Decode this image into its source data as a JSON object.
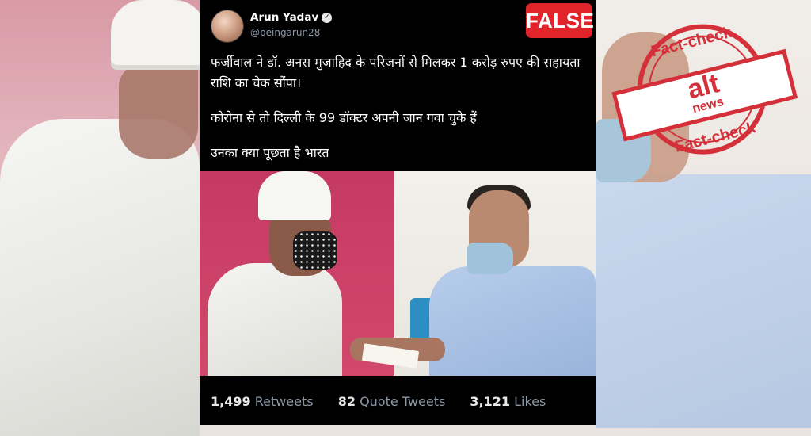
{
  "tweet": {
    "author_name": "Arun Yadav",
    "author_handle": "@beingarun28",
    "verified_icon": "verified-badge-icon",
    "lines": [
      "फर्जीवाल ने डॉ. अनस मुजाहिद के परिजनों से मिलकर 1 करोड़ रुपए की सहायता राशि का चेक सौंपा।",
      "कोरोना से तो दिल्ली के 99 डॉक्टर अपनी जान गवा चुके हैं",
      "उनका क्या पूछता है भारत"
    ],
    "stats": {
      "retweets_count": "1,499",
      "retweets_label": "Retweets",
      "quote_count": "82",
      "quote_label": "Quote Tweets",
      "likes_count": "3,121",
      "likes_label": "Likes"
    }
  },
  "verdict_badge": "FALSE",
  "stamp": {
    "top_text": "Fact-check",
    "bottom_text": "Fact-check",
    "logo_alt": "alt",
    "logo_news": "news"
  },
  "colors": {
    "badge_red": "#e0242a",
    "stamp_red": "#d3303a",
    "tweet_bg": "#000000",
    "muted_text": "#8b98a5"
  }
}
